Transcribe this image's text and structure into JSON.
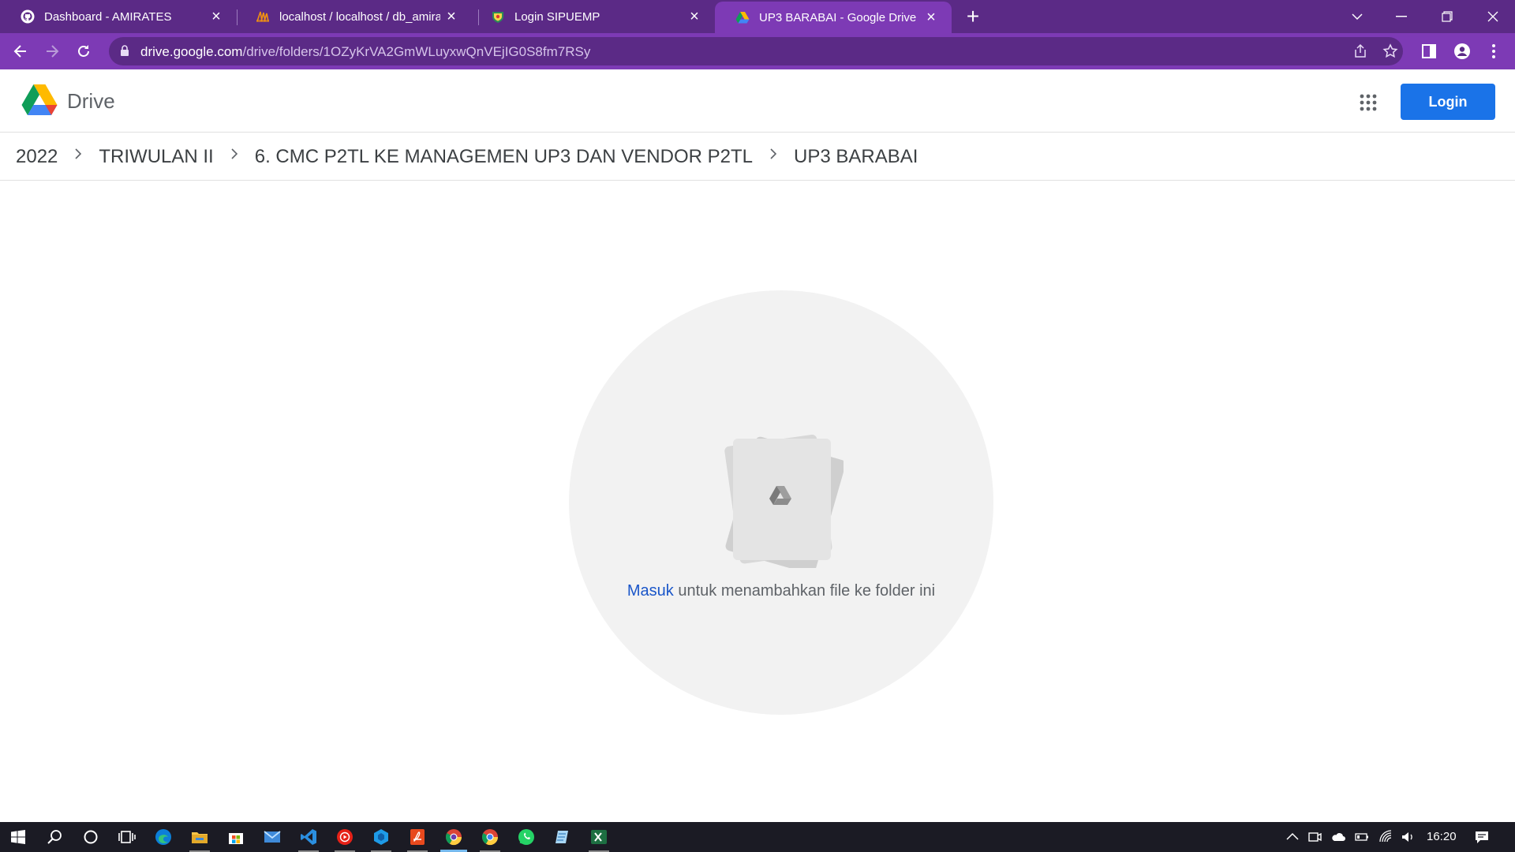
{
  "browser": {
    "tabs": [
      {
        "title": "Dashboard - AMIRATES",
        "icon": "github-icon",
        "active": false
      },
      {
        "title": "localhost / localhost / db_amirates",
        "icon": "phpmyadmin-icon",
        "active": false
      },
      {
        "title": "Login SIPUEMP",
        "icon": "sipuemp-icon",
        "active": false
      },
      {
        "title": "UP3 BARABAI - Google Drive",
        "icon": "google-drive-icon",
        "active": true
      }
    ],
    "url_host": "drive.google.com",
    "url_path": "/drive/folders/1OZyKrVA2GmWLuyxwQnVEjIG0S8fm7RSy"
  },
  "drive": {
    "app_name": "Drive",
    "login_label": "Login"
  },
  "breadcrumb": [
    "2022",
    "TRIWULAN II",
    "6. CMC P2TL KE MANAGEMEN UP3 DAN VENDOR P2TL",
    "UP3 BARABAI"
  ],
  "empty_state": {
    "link_text": "Masuk",
    "message": " untuk menambahkan file ke folder ini"
  },
  "taskbar": {
    "time": "16:20",
    "apps": [
      "start-icon",
      "search-icon",
      "cortana-icon",
      "task-view-icon",
      "edge-icon",
      "file-explorer-icon",
      "store-icon",
      "mail-icon",
      "vscode-icon",
      "youtube-music-icon",
      "app-icon",
      "pdf-icon",
      "chrome-icon",
      "chrome-icon",
      "whatsapp-icon",
      "notepad-icon",
      "excel-icon"
    ]
  },
  "colors": {
    "chrome_frame": "#5b2a86",
    "chrome_toolbar": "#7d3ab5",
    "login_button": "#1a73e8",
    "link": "#1a56c9"
  }
}
